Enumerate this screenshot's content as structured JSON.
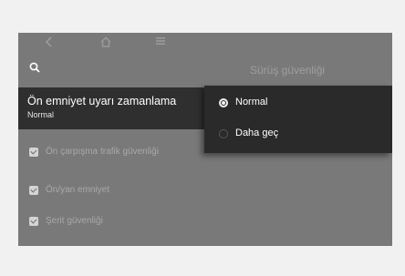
{
  "screen": {
    "top_bar": {
      "back_icon": "back-arrow-icon",
      "home_icon": "home-icon",
      "menu_icon": "menu-icon"
    },
    "search_icon": "search-icon",
    "section_title": "Sürüş güvenliği"
  },
  "timing": {
    "title": "Ön emniyet uyarı zamanlama",
    "value": "Normal"
  },
  "dropdown": {
    "options": [
      {
        "label": "Normal",
        "selected": true
      },
      {
        "label": "Daha geç",
        "selected": false
      }
    ]
  },
  "checkboxes": [
    {
      "label": "Ön çarpışma trafik güvenliği",
      "checked": true
    },
    {
      "label": "Ön/yan emniyet",
      "checked": true
    },
    {
      "label": "Şerit güvenliği",
      "checked": true
    }
  ],
  "colors": {
    "background": "#f1f1f1",
    "screen": "#797979",
    "highlight_row": "#2f2f2f",
    "dropdown": "#2a2a2a"
  }
}
